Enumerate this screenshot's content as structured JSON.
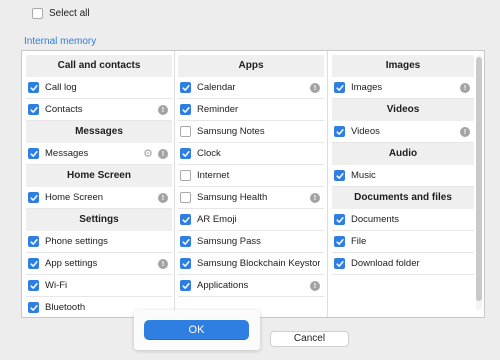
{
  "select_all": {
    "label": "Select all",
    "checked": false
  },
  "section_title": "Internal memory",
  "colors": {
    "accent": "#2f7fe3",
    "checkbox_checked": "#2f7fe3",
    "info_icon": "#a3a3a3"
  },
  "columns": [
    {
      "groups": [
        {
          "title": "Call and contacts",
          "items": [
            {
              "label": "Call log",
              "checked": true,
              "info": false,
              "gear": false
            },
            {
              "label": "Contacts",
              "checked": true,
              "info": true,
              "gear": false
            }
          ]
        },
        {
          "title": "Messages",
          "items": [
            {
              "label": "Messages",
              "checked": true,
              "info": true,
              "gear": true
            }
          ]
        },
        {
          "title": "Home Screen",
          "items": [
            {
              "label": "Home Screen",
              "checked": true,
              "info": true,
              "gear": false
            }
          ]
        },
        {
          "title": "Settings",
          "items": [
            {
              "label": "Phone settings",
              "checked": true,
              "info": false,
              "gear": false
            },
            {
              "label": "App settings",
              "checked": true,
              "info": true,
              "gear": false
            },
            {
              "label": "Wi-Fi",
              "checked": true,
              "info": false,
              "gear": false
            },
            {
              "label": "Bluetooth",
              "checked": true,
              "info": false,
              "gear": false
            }
          ]
        }
      ]
    },
    {
      "groups": [
        {
          "title": "Apps",
          "items": [
            {
              "label": "Calendar",
              "checked": true,
              "info": true,
              "gear": false
            },
            {
              "label": "Reminder",
              "checked": true,
              "info": false,
              "gear": false
            },
            {
              "label": "Samsung Notes",
              "checked": false,
              "info": false,
              "gear": false
            },
            {
              "label": "Clock",
              "checked": true,
              "info": false,
              "gear": false
            },
            {
              "label": "Internet",
              "checked": false,
              "info": false,
              "gear": false
            },
            {
              "label": "Samsung Health",
              "checked": false,
              "info": true,
              "gear": false
            },
            {
              "label": "AR Emoji",
              "checked": true,
              "info": false,
              "gear": false
            },
            {
              "label": "Samsung Pass",
              "checked": true,
              "info": false,
              "gear": false
            },
            {
              "label": "Samsung Blockchain Keystore",
              "checked": true,
              "info": false,
              "gear": false
            },
            {
              "label": "Applications",
              "checked": true,
              "info": true,
              "gear": false
            }
          ]
        }
      ]
    },
    {
      "groups": [
        {
          "title": "Images",
          "items": [
            {
              "label": "Images",
              "checked": true,
              "info": true,
              "gear": false
            }
          ]
        },
        {
          "title": "Videos",
          "items": [
            {
              "label": "Videos",
              "checked": true,
              "info": true,
              "gear": false
            }
          ]
        },
        {
          "title": "Audio",
          "items": [
            {
              "label": "Music",
              "checked": true,
              "info": false,
              "gear": false
            }
          ]
        },
        {
          "title": "Documents and files",
          "items": [
            {
              "label": "Documents",
              "checked": true,
              "info": false,
              "gear": false
            },
            {
              "label": "File",
              "checked": true,
              "info": false,
              "gear": false
            },
            {
              "label": "Download folder",
              "checked": true,
              "info": false,
              "gear": false
            }
          ]
        }
      ]
    }
  ],
  "buttons": {
    "ok_label": "OK",
    "cancel_label": "Cancel"
  }
}
